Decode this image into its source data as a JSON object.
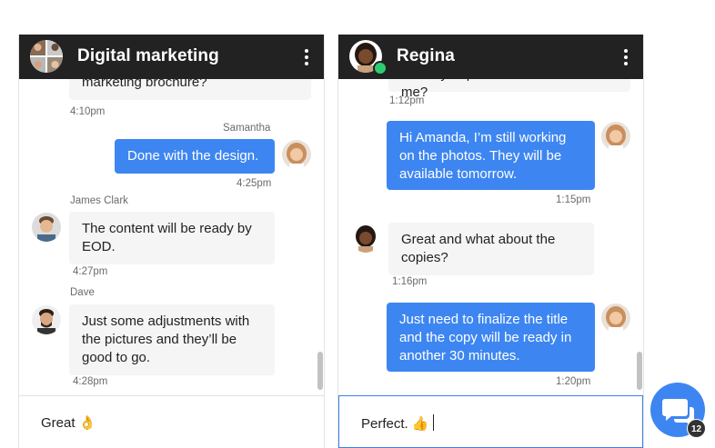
{
  "colors": {
    "header_bg": "#222222",
    "accent": "#3d86f2",
    "incoming_bg": "#f5f5f5",
    "online": "#2ecc71"
  },
  "left_chat": {
    "title": "Digital marketing",
    "menu_icon": "more-vertical-icon",
    "messages": [
      {
        "text": "marketing brochure?",
        "time": "4:10pm"
      },
      {
        "sender": "Samantha",
        "text": "Done with the design.",
        "time": "4:25pm"
      },
      {
        "sender": "James Clark",
        "text": "The content will be ready by EOD.",
        "time": "4:27pm"
      },
      {
        "sender": "Dave",
        "text": "Just some adjustments with the pictures and they’ll be good to go.",
        "time": "4:28pm"
      }
    ],
    "composer_text": "Great 👌"
  },
  "right_chat": {
    "title": "Regina",
    "menu_icon": "more-vertical-icon",
    "messages": [
      {
        "text": "Could you please send them to me?",
        "time": "1:12pm"
      },
      {
        "text": "Hi Amanda, I’m still working on the photos. They will be available tomorrow.",
        "time": "1:15pm"
      },
      {
        "text": "Great and what about the copies?",
        "time": "1:16pm"
      },
      {
        "text": "Just need to finalize the title and the copy will be ready in another 30 minutes.",
        "time": "1:20pm"
      }
    ],
    "composer_text": "Perfect. 👍"
  },
  "launcher": {
    "icon": "chat-bubbles-icon",
    "badge_count": "12"
  }
}
